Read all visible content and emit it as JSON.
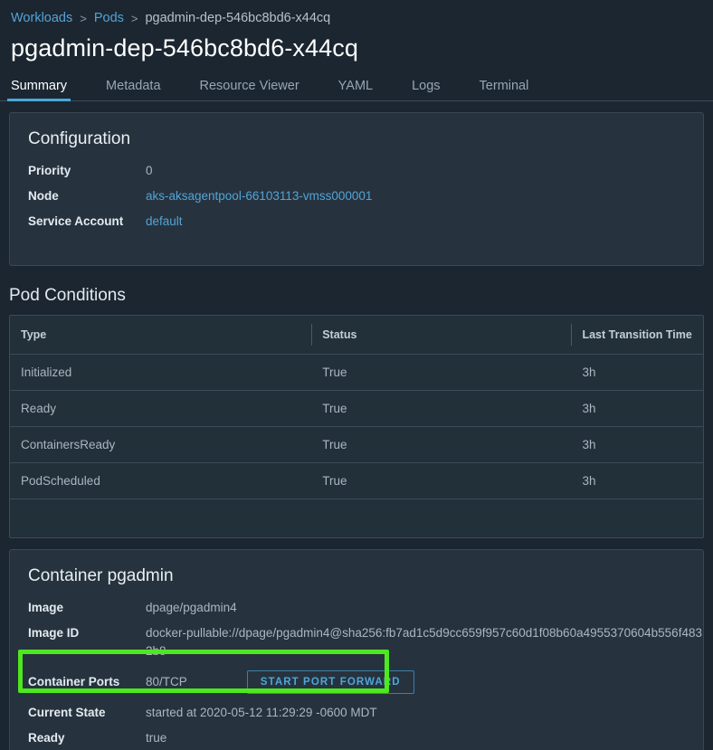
{
  "breadcrumb": {
    "items": [
      {
        "label": "Workloads",
        "type": "link"
      },
      {
        "label": "Pods",
        "type": "link"
      },
      {
        "label": "pgadmin-dep-546bc8bd6-x44cq",
        "type": "current"
      }
    ],
    "separator": ">"
  },
  "page_title": "pgadmin-dep-546bc8bd6-x44cq",
  "tabs": [
    {
      "label": "Summary",
      "active": true
    },
    {
      "label": "Metadata",
      "active": false
    },
    {
      "label": "Resource Viewer",
      "active": false
    },
    {
      "label": "YAML",
      "active": false
    },
    {
      "label": "Logs",
      "active": false
    },
    {
      "label": "Terminal",
      "active": false
    }
  ],
  "configuration": {
    "title": "Configuration",
    "rows": [
      {
        "key": "Priority",
        "value": "0",
        "link": false
      },
      {
        "key": "Node",
        "value": "aks-aksagentpool-66103113-vmss000001",
        "link": true
      },
      {
        "key": "Service Account",
        "value": "default",
        "link": true
      }
    ]
  },
  "pod_conditions": {
    "heading": "Pod Conditions",
    "columns": [
      "Type",
      "Status",
      "Last Transition Time"
    ],
    "rows": [
      {
        "type": "Initialized",
        "status": "True",
        "last_transition_time": "3h"
      },
      {
        "type": "Ready",
        "status": "True",
        "last_transition_time": "3h"
      },
      {
        "type": "ContainersReady",
        "status": "True",
        "last_transition_time": "3h"
      },
      {
        "type": "PodScheduled",
        "status": "True",
        "last_transition_time": "3h"
      }
    ]
  },
  "container": {
    "title": "Container pgadmin",
    "image_label": "Image",
    "image_value": "dpage/pgadmin4",
    "image_id_label": "Image ID",
    "image_id_value": "docker-pullable://dpage/pgadmin4@sha256:fb7ad1c5d9cc659f957c60d1f08b60a4955370604b556f4832b8",
    "ports_label": "Container Ports",
    "ports_value": "80/TCP",
    "port_forward_button": "START PORT FORWARD",
    "current_state_label": "Current State",
    "current_state_value": "started at 2020-05-12 11:29:29 -0600 MDT",
    "ready_label": "Ready",
    "ready_value": "true"
  },
  "colors": {
    "page_background": "#1b2631",
    "card_background": "#26333e",
    "accent_link": "#54a3d6",
    "tab_underline": "#4fa6d8",
    "annotation_highlight": "#4ee81f",
    "text_primary": "#e9eef2",
    "text_secondary": "#aab6c1"
  }
}
